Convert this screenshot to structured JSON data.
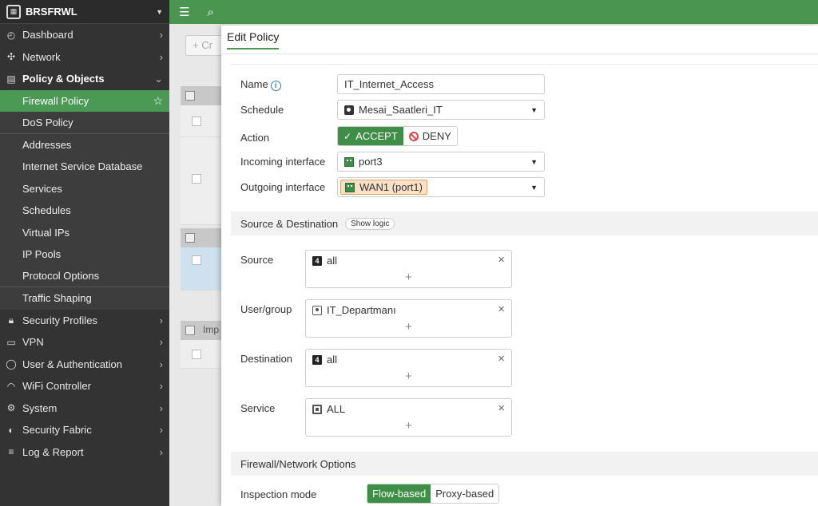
{
  "device": {
    "name": "BRSFRWL"
  },
  "sidebar": {
    "items": [
      {
        "label": "Dashboard",
        "icon": "dashboard-icon"
      },
      {
        "label": "Network",
        "icon": "network-icon"
      },
      {
        "label": "Policy & Objects",
        "icon": "policy-icon",
        "expanded": true
      },
      {
        "label": "Security Profiles",
        "icon": "lock-icon"
      },
      {
        "label": "VPN",
        "icon": "laptop-icon"
      },
      {
        "label": "User & Authentication",
        "icon": "user-icon"
      },
      {
        "label": "WiFi Controller",
        "icon": "wifi-icon"
      },
      {
        "label": "System",
        "icon": "gear-icon"
      },
      {
        "label": "Security Fabric",
        "icon": "fabric-icon"
      },
      {
        "label": "Log & Report",
        "icon": "log-icon"
      }
    ],
    "policy_sub": [
      "Firewall Policy",
      "DoS Policy",
      "Addresses",
      "Internet Service Database",
      "Services",
      "Schedules",
      "Virtual IPs",
      "IP Pools",
      "Protocol Options",
      "Traffic Shaping"
    ],
    "active_sub": "Firewall Policy"
  },
  "background": {
    "create_label": "+ Cr",
    "group3_label": "Imp"
  },
  "panel": {
    "title": "Edit Policy",
    "name_label": "Name",
    "name_value": "IT_Internet_Access",
    "schedule_label": "Schedule",
    "schedule_value": "Mesai_Saatleri_IT",
    "action_label": "Action",
    "action_accept": "ACCEPT",
    "action_deny": "DENY",
    "incoming_label": "Incoming interface",
    "incoming_value": "port3",
    "outgoing_label": "Outgoing interface",
    "outgoing_value": "WAN1 (port1)",
    "section_srcdst": "Source & Destination",
    "show_logic": "Show logic",
    "source_label": "Source",
    "source_value": "all",
    "usergroup_label": "User/group",
    "usergroup_value": "IT_Departmanı",
    "destination_label": "Destination",
    "destination_value": "all",
    "service_label": "Service",
    "service_value": "ALL",
    "section_fw": "Firewall/Network Options",
    "inspection_label": "Inspection mode",
    "flow_based": "Flow-based",
    "proxy_based": "Proxy-based"
  },
  "colors": {
    "accent": "#4a9550",
    "sidebar": "#333333",
    "active": "#4a9a55"
  }
}
